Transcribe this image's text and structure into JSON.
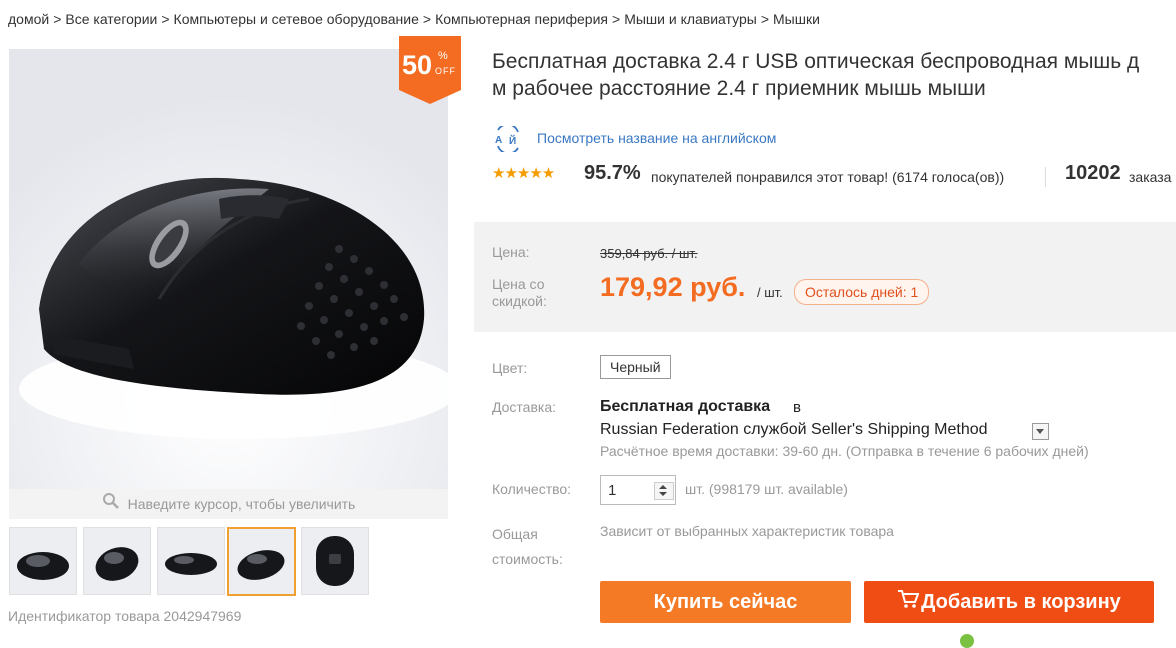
{
  "breadcrumb": {
    "items": [
      "домой",
      "Все категории",
      "Компьютеры и сетевое оборудование",
      "Компьютерная периферия",
      "Мыши и клавиатуры",
      "Мышки"
    ],
    "separator": ">"
  },
  "gallery": {
    "discount": {
      "value": "50",
      "percent": "%",
      "off": "OFF"
    },
    "zoom_hint": "Наведите курсор, чтобы увеличить",
    "thumbnails_count": 5,
    "active_thumbnail": 4
  },
  "product_id_label": "Идентификатор товара 2042947969",
  "title": {
    "line1": "Бесплатная доставка 2.4 г USB оптическая беспроводная мышь д",
    "line2": "м рабочее расстояние 2.4 г приемник мышь мыши"
  },
  "translate_link": "Посмотреть название на английском",
  "rating": {
    "stars": 5,
    "percent": "95.7%",
    "votes_text": "покупателей понравился этот товар! (6174 голоса(ов))",
    "orders_count": "10202",
    "orders_label": "заказа"
  },
  "price": {
    "label": "Цена:",
    "old_price": "359,84 руб. / шт.",
    "discount_label": "Цена со скидкой:",
    "new_price": "179,92 руб.",
    "per_unit": "/ шт.",
    "days_left": "Осталось дней: 1"
  },
  "color": {
    "label": "Цвет:",
    "value": "Черный"
  },
  "shipping": {
    "label": "Доставка:",
    "free": "Бесплатная доставка",
    "in": "в",
    "destination": "Russian Federation службой Seller's Shipping Method",
    "time": "Расчётное время доставки: 39-60 дн. (Отправка в течение 6 рабочих дней)"
  },
  "quantity": {
    "label": "Количество:",
    "value": "1",
    "unit": "шт. (998179 шт. available)"
  },
  "total": {
    "label": "Общая стоимость:",
    "value": "Зависит от выбранных характеристик товара"
  },
  "buttons": {
    "buy_now": "Купить сейчас",
    "add_to_cart": "Добавить в корзину"
  },
  "colors": {
    "accent": "#f36c21",
    "buy": "#f47a26",
    "cart": "#f04d14",
    "link": "#3a78c3",
    "star": "#f49c00"
  }
}
